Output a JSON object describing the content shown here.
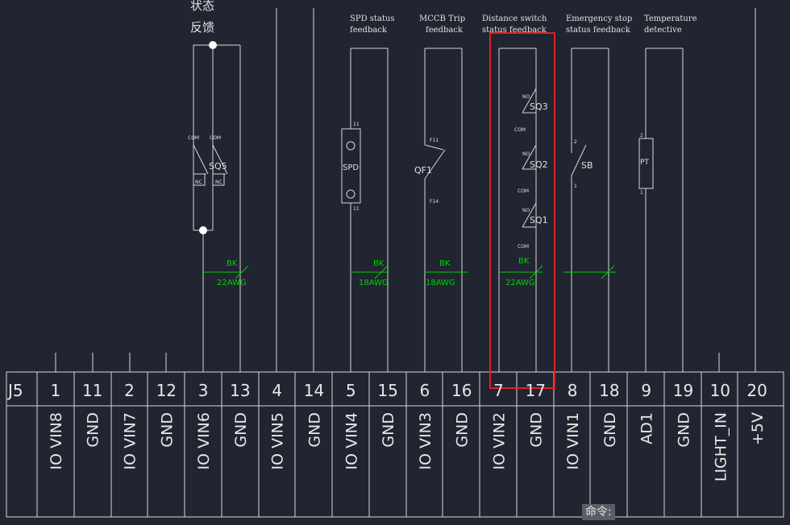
{
  "connector": {
    "id": "J5",
    "pins": [
      {
        "num": "1",
        "signal": "IO VIN8"
      },
      {
        "num": "11",
        "signal": "GND"
      },
      {
        "num": "2",
        "signal": "IO VIN7"
      },
      {
        "num": "12",
        "signal": "GND"
      },
      {
        "num": "3",
        "signal": "IO VIN6"
      },
      {
        "num": "13",
        "signal": "GND"
      },
      {
        "num": "4",
        "signal": "IO VIN5"
      },
      {
        "num": "14",
        "signal": "GND"
      },
      {
        "num": "5",
        "signal": "IO VIN4"
      },
      {
        "num": "15",
        "signal": "GND"
      },
      {
        "num": "6",
        "signal": "IO VIN3"
      },
      {
        "num": "16",
        "signal": "GND"
      },
      {
        "num": "7",
        "signal": "IO VIN2"
      },
      {
        "num": "17",
        "signal": "GND"
      },
      {
        "num": "8",
        "signal": "IO VIN1"
      },
      {
        "num": "18",
        "signal": "GND"
      },
      {
        "num": "9",
        "signal": "AD1"
      },
      {
        "num": "19",
        "signal": "GND"
      },
      {
        "num": "10",
        "signal": "LIGHT_IN"
      },
      {
        "num": "20",
        "signal": "+5V"
      }
    ]
  },
  "headers": {
    "status_cn_1": "状态",
    "status_cn_2": "反馈",
    "spd_1": "SPD status",
    "spd_2": "feedback",
    "mccb_1": "MCCB Trip",
    "mccb_2": "feedback",
    "dist_1": "Distance switch",
    "dist_2": "status feedback",
    "estop_1": "Emergency stop",
    "estop_2": "status feedback",
    "temp_1": "Temperature",
    "temp_2": "detective"
  },
  "components": {
    "sq5": {
      "label": "SQ5",
      "com": "COM",
      "nc": "NC"
    },
    "spd": {
      "label": "SPD",
      "pin_top": "11",
      "pin_bottom": "12"
    },
    "qf1": {
      "label": "QF1",
      "pin_top": "F11",
      "pin_bottom": "F14"
    },
    "sq3": {
      "label": "SQ3",
      "no": "NO",
      "com": "COM"
    },
    "sq2": {
      "label": "SQ2",
      "no": "NO",
      "com": "COM"
    },
    "sq1": {
      "label": "SQ1",
      "no": "NO",
      "com": "COM"
    },
    "sb": {
      "label": "SB",
      "pin_top": "2",
      "pin_bottom": "1"
    },
    "pt": {
      "label": "PT",
      "pin_top": "2",
      "pin_bottom": "1"
    }
  },
  "wires": [
    {
      "color": "BK",
      "gauge": "22AWG"
    },
    {
      "color": "BK",
      "gauge": "18AWG"
    },
    {
      "color": "BK",
      "gauge": "18AWG"
    },
    {
      "color": "BK",
      "gauge": "22AWG"
    }
  ],
  "command_bar": {
    "label": "命令:"
  },
  "colors": {
    "background": "#202531",
    "line": "#d8d8d8",
    "wire_label": "#00d000",
    "highlight": "#e02020"
  }
}
